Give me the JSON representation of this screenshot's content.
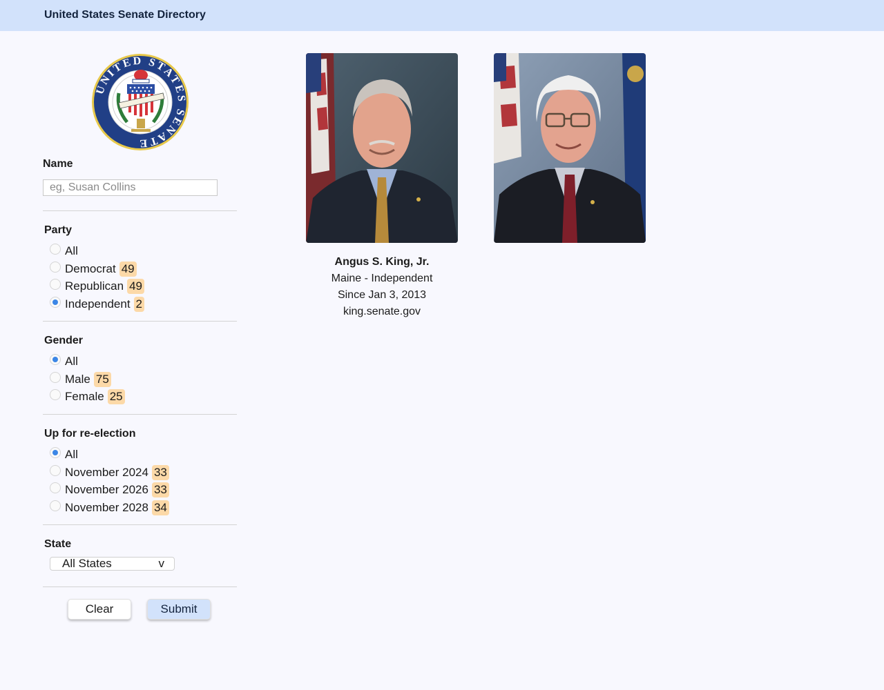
{
  "header": {
    "title": "United States Senate Directory"
  },
  "seal": {
    "icon": "senate-seal-icon",
    "ring_text_top": "UNITED STATES SENATE",
    "banner_text": "E PLURIBUS UNUM",
    "cap_text": "LIBERTAS"
  },
  "filters": {
    "name": {
      "label": "Name",
      "placeholder": "eg, Susan Collins",
      "value": ""
    },
    "party": {
      "label": "Party",
      "options": [
        {
          "label": "All",
          "count": null,
          "checked": false
        },
        {
          "label": "Democrat",
          "count": "49",
          "checked": false
        },
        {
          "label": "Republican",
          "count": "49",
          "checked": false
        },
        {
          "label": "Independent",
          "count": "2",
          "checked": true
        }
      ]
    },
    "gender": {
      "label": "Gender",
      "options": [
        {
          "label": "All",
          "count": null,
          "checked": true
        },
        {
          "label": "Male",
          "count": "75",
          "checked": false
        },
        {
          "label": "Female",
          "count": "25",
          "checked": false
        }
      ]
    },
    "reelection": {
      "label": "Up for re-election",
      "options": [
        {
          "label": "All",
          "count": null,
          "checked": true
        },
        {
          "label": "November 2024",
          "count": "33",
          "checked": false
        },
        {
          "label": "November 2026",
          "count": "33",
          "checked": false
        },
        {
          "label": "November 2028",
          "count": "34",
          "checked": false
        }
      ]
    },
    "state": {
      "label": "State",
      "selected": "All States",
      "arrow": "v"
    }
  },
  "buttons": {
    "clear": "Clear",
    "submit": "Submit"
  },
  "senators": [
    {
      "name": "Angus S. King, Jr.",
      "state_party": "Maine - Independent",
      "since": "Since Jan 3, 2013",
      "website": "king.senate.gov",
      "show_details": true
    },
    {
      "name": "",
      "state_party": "",
      "since": "",
      "website": "",
      "show_details": false
    }
  ],
  "colors": {
    "header_bg": "#d2e2fb",
    "count_badge": "#fcd9a8",
    "radio_checked": "#3b86e6",
    "submit_bg": "#d2e2fb"
  }
}
